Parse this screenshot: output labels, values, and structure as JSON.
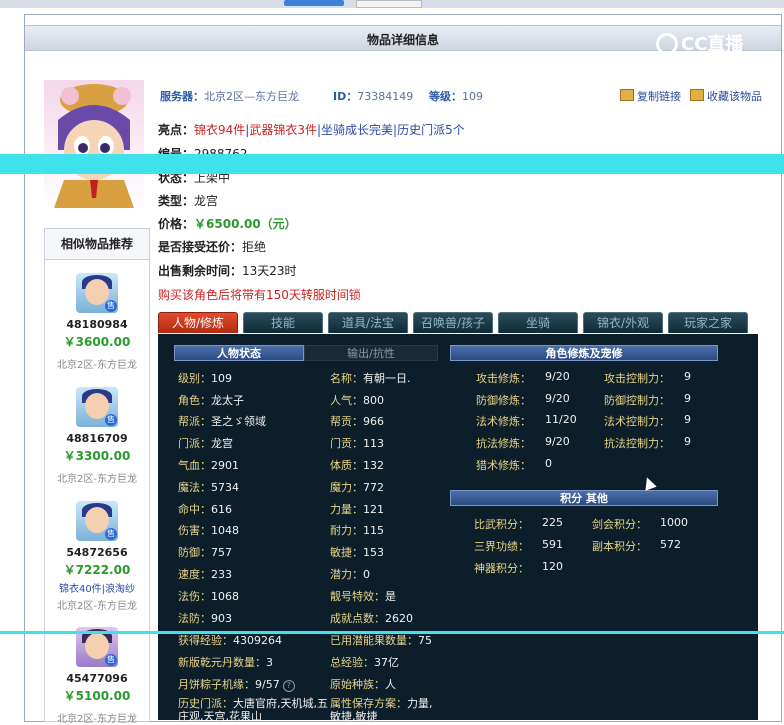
{
  "page_title": "物品详细信息",
  "logo": "CC直播",
  "server_label": "服务器：",
  "server": "北京2区—东方巨龙",
  "id_label": "ID：",
  "id": "73384149",
  "level_label": "等级：",
  "level": "109",
  "copy_link": "复制链接",
  "favorite": "收藏该物品",
  "highlights_label": "亮点：",
  "highlights": [
    "锦衣94件",
    "武器锦衣3件",
    "坐骑成长完美",
    "历史门派5个"
  ],
  "number_label": "编号：",
  "number": "2988762",
  "status_label": "状态：",
  "status": "上架中",
  "type_label": "类型：",
  "type": "龙宫",
  "price_label": "价格：",
  "price": "￥6500.00（元）",
  "bargain_label": "是否接受还价：",
  "bargain": "拒绝",
  "remaining_label": "出售剩余时间：",
  "remaining": "13天23时",
  "notice": "购买该角色后将带有150天转服时间锁",
  "similar_title": "相似物品推荐",
  "similar_items": [
    {
      "id": "48180984",
      "price": "￥3600.00",
      "server": "北京2区-东方巨龙",
      "extra": ""
    },
    {
      "id": "48816709",
      "price": "￥3300.00",
      "server": "北京2区-东方巨龙",
      "extra": ""
    },
    {
      "id": "54872656",
      "price": "￥7222.00",
      "server": "北京2区-东方巨龙",
      "extra": "锦衣40件|浪淘纱"
    },
    {
      "id": "45477096",
      "price": "￥5100.00",
      "server": "北京2区-东方巨龙",
      "extra": ""
    }
  ],
  "sale_badge": "售",
  "tabs": [
    "人物/修炼",
    "技能",
    "道具/法宝",
    "召唤兽/孩子",
    "坐骑",
    "锦衣/外观",
    "玩家之家"
  ],
  "subtabs": {
    "status": "人物状态",
    "output": "输出/抗性",
    "cultivation": "角色修炼及宠修",
    "points": "积分 其他"
  },
  "stats_left": [
    [
      "级别：",
      "109"
    ],
    [
      "角色：",
      "龙太子"
    ],
    [
      "帮派：",
      "圣之ゞ领域"
    ],
    [
      "门派：",
      "龙宫"
    ],
    [
      "气血：",
      "2901"
    ],
    [
      "魔法：",
      "5734"
    ],
    [
      "命中：",
      "616"
    ],
    [
      "伤害：",
      "1048"
    ],
    [
      "防御：",
      "757"
    ],
    [
      "速度：",
      "233"
    ],
    [
      "法伤：",
      "1068"
    ],
    [
      "法防：",
      "903"
    ]
  ],
  "stats_mid": [
    [
      "名称：",
      "有朝一日."
    ],
    [
      "人气：",
      "800"
    ],
    [
      "帮贡：",
      "966"
    ],
    [
      "门贡：",
      "113"
    ],
    [
      "体质：",
      "132"
    ],
    [
      "魔力：",
      "772"
    ],
    [
      "力量：",
      "121"
    ],
    [
      "耐力：",
      "115"
    ],
    [
      "敏捷：",
      "153"
    ],
    [
      "潜力：",
      "0"
    ],
    [
      "靓号特效：",
      "是"
    ],
    [
      "成就点数：",
      "2620"
    ]
  ],
  "bottom_stats": [
    [
      "获得经验：",
      "4309264"
    ],
    [
      "已用潜能果数量：",
      "75"
    ],
    [
      "新版乾元丹数量：",
      "3"
    ],
    [
      "总经验：",
      "37亿"
    ],
    [
      "月饼粽子机缘：",
      "9/57"
    ],
    [
      "原始种族：",
      "人"
    ]
  ],
  "history_label": "历史门派：",
  "history_value": "大唐官府,天机城,五庄观,天宫,花果山",
  "attr_scheme_label": "属性保存方案：",
  "attr_scheme_value": "力量,敏捷,敏捷",
  "cultivation": [
    [
      "攻击修炼：",
      "9/20",
      "攻击控制力：",
      "9"
    ],
    [
      "防御修炼：",
      "9/20",
      "防御控制力：",
      "9"
    ],
    [
      "法术修炼：",
      "11/20",
      "法术控制力：",
      "9"
    ],
    [
      "抗法修炼：",
      "9/20",
      "抗法控制力：",
      "9"
    ],
    [
      "猎术修炼：",
      "0",
      "",
      ""
    ]
  ],
  "points": [
    [
      "比武积分：",
      "225",
      "剑会积分：",
      "1000"
    ],
    [
      "三界功绩：",
      "591",
      "副本积分：",
      "572"
    ],
    [
      "神器积分：",
      "120",
      "",
      ""
    ]
  ]
}
